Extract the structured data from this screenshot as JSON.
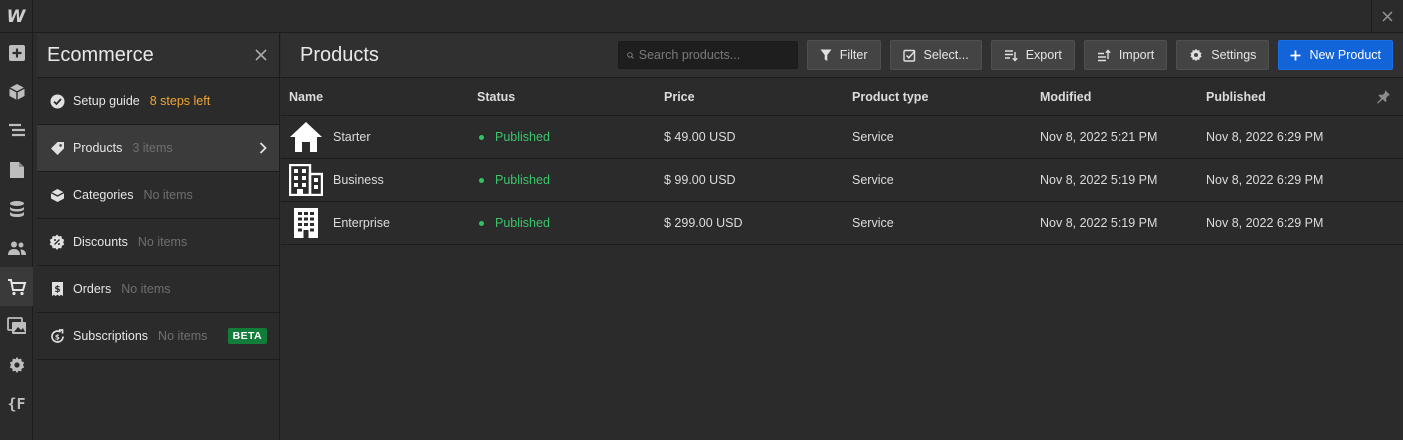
{
  "app": {
    "logo": "W"
  },
  "rail": {
    "icons": [
      "add-icon",
      "box-icon",
      "navigator-icon",
      "pages-icon",
      "cms-icon",
      "users-icon",
      "ecommerce-cart-icon",
      "assets-icon",
      "settings-icon",
      "variables-icon"
    ],
    "active_index": 6
  },
  "panel": {
    "title": "Ecommerce",
    "items": [
      {
        "label": "Setup guide",
        "sub": "8 steps left",
        "icon": "check-circle-icon"
      },
      {
        "label": "Products",
        "sub": "3 items",
        "icon": "tag-icon"
      },
      {
        "label": "Categories",
        "sub": "No items",
        "icon": "category-icon"
      },
      {
        "label": "Discounts",
        "sub": "No items",
        "icon": "discount-badge-icon"
      },
      {
        "label": "Orders",
        "sub": "No items",
        "icon": "receipt-icon"
      },
      {
        "label": "Subscriptions",
        "sub": "No items",
        "icon": "subscription-icon",
        "badge": "BETA"
      }
    ]
  },
  "main": {
    "title": "Products",
    "search_placeholder": "Search products...",
    "buttons": {
      "filter": "Filter",
      "select": "Select...",
      "export": "Export",
      "import": "Import",
      "settings": "Settings",
      "new_product": "New Product"
    }
  },
  "table": {
    "columns": [
      "Name",
      "Status",
      "Price",
      "Product type",
      "Modified",
      "Published"
    ],
    "rows": [
      {
        "name": "Starter",
        "status": "Published",
        "price": "$ 49.00 USD",
        "type": "Service",
        "modified": "Nov 8, 2022 5:21 PM",
        "published": "Nov 8, 2022 6:29 PM",
        "icon": "house-icon"
      },
      {
        "name": "Business",
        "status": "Published",
        "price": "$ 99.00 USD",
        "type": "Service",
        "modified": "Nov 8, 2022 5:19 PM",
        "published": "Nov 8, 2022 6:29 PM",
        "icon": "office-building-icon"
      },
      {
        "name": "Enterprise",
        "status": "Published",
        "price": "$ 299.00 USD",
        "type": "Service",
        "modified": "Nov 8, 2022 5:19 PM",
        "published": "Nov 8, 2022 6:29 PM",
        "icon": "skyscraper-icon"
      }
    ]
  },
  "colors": {
    "accent": "#1363d9",
    "published": "#3cc46b",
    "setup_hint": "#f0a72e",
    "beta": "#127d3a"
  }
}
